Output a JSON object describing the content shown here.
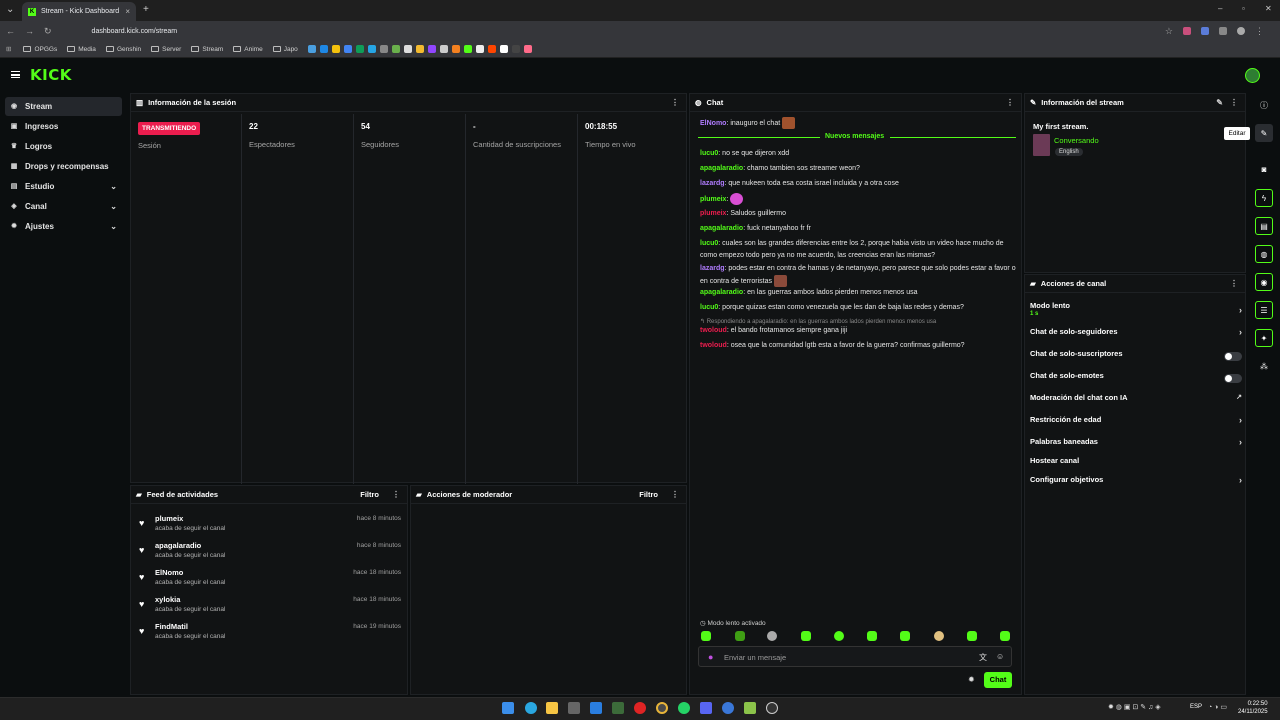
{
  "browser": {
    "tab_title": "Stream - Kick Dashboard",
    "url": "dashboard.kick.com/stream",
    "bookmarks": [
      "OPGGs",
      "Media",
      "Genshin",
      "Server",
      "Stream",
      "Anime",
      "Japo"
    ]
  },
  "brand": {
    "logo": "KICK",
    "accent": "#53fc18"
  },
  "nav": {
    "items": [
      {
        "label": "Stream",
        "icon": "broadcast-icon"
      },
      {
        "label": "Ingresos",
        "icon": "wallet-icon"
      },
      {
        "label": "Logros",
        "icon": "trophy-icon"
      },
      {
        "label": "Drops y recompensas",
        "icon": "gift-icon"
      },
      {
        "label": "Estudio",
        "icon": "studio-icon"
      },
      {
        "label": "Canal",
        "icon": "channel-icon"
      },
      {
        "label": "Ajustes",
        "icon": "gear-icon"
      }
    ]
  },
  "session": {
    "title": "Información de la sesión",
    "badge": "TRANSMITIENDO",
    "badge_label": "Sesión",
    "stats": [
      {
        "value": "22",
        "label": "Espectadores"
      },
      {
        "value": "54",
        "label": "Seguidores"
      },
      {
        "value": "-",
        "label": "Cantidad de suscripciones"
      },
      {
        "value": "00:18:55",
        "label": "Tiempo en vivo"
      }
    ]
  },
  "feed": {
    "title": "Feed de actividades",
    "filter": "Filtro",
    "items": [
      {
        "name": "plumeix",
        "sub": "acaba de seguir el canal",
        "time": "hace 8 minutos"
      },
      {
        "name": "apagalaradio",
        "sub": "acaba de seguir el canal",
        "time": "hace 8 minutos"
      },
      {
        "name": "ElNomo",
        "sub": "acaba de seguir el canal",
        "time": "hace 18 minutos"
      },
      {
        "name": "xylokia",
        "sub": "acaba de seguir el canal",
        "time": "hace 18 minutos"
      },
      {
        "name": "FindMatil",
        "sub": "acaba de seguir el canal",
        "time": "hace 19 minutos"
      }
    ]
  },
  "moderator": {
    "title": "Acciones de moderador",
    "filter": "Filtro"
  },
  "chat": {
    "title": "Chat",
    "new_messages": "Nuevos mensajes",
    "first": {
      "user": "ElNomo",
      "text": ": inauguro el chat",
      "color": "#b07cff"
    },
    "messages": [
      {
        "user": "lucu0",
        "text": ": no se que dijeron xdd",
        "color": "#53fc18"
      },
      {
        "user": "apagalaradio",
        "text": ": chamo tambien sos streamer weon?",
        "color": "#53fc18"
      },
      {
        "user": "lazardg",
        "text": ": que nukeen toda esa costa israel incluida y a otra cose",
        "color": "#b07cff"
      },
      {
        "user": "plumeix",
        "text": ":",
        "color": "#53fc18"
      },
      {
        "user": "plumeix",
        "text": ": Saludos guillermo",
        "color": "#eb1d4e"
      },
      {
        "user": "apagalaradio",
        "text": ": fuck netanyahoo fr fr",
        "color": "#53fc18"
      },
      {
        "user": "lucu0",
        "text": ": cuales son las grandes diferencias entre los 2, porque habia visto un video hace mucho de como empezo todo pero ya no me acuerdo, las creencias eran las mismas?",
        "color": "#53fc18"
      },
      {
        "user": "lazardg",
        "text": ": podes estar en contra de hamas y de netanyayo, pero parece que solo podes estar a favor o en contra de terroristas",
        "color": "#b07cff"
      },
      {
        "user": "apagalaradio",
        "text": ": en las guerras ambos lados pierden menos menos usa",
        "color": "#53fc18"
      },
      {
        "user": "lucu0",
        "text": ": porque quizas estan como venezuela que les dan de baja las redes y demas?",
        "color": "#53fc18"
      },
      {
        "user": "twoloud",
        "text": ": el bando frotamanos siempre gana jiji",
        "color": "#eb1d4e"
      },
      {
        "user": "twoloud",
        "text": ": osea que la comunidad lgtb esta a favor de la guerra? confirmas guillermo?",
        "color": "#eb1d4e"
      }
    ],
    "reply_hint": "Respondiendo a apagalaradio: en las guerras ambos lados pierden menos menos usa",
    "slow_mode": "Modo lento activado",
    "placeholder": "Enviar un mensaje",
    "send": "Chat"
  },
  "stream_info": {
    "title": "Información del stream",
    "stream_title": "My first stream.",
    "category": "Conversando",
    "language": "English",
    "tooltip": "Editar"
  },
  "channel_actions": {
    "title": "Acciones de canal",
    "slow_mode": {
      "label": "Modo lento",
      "value": "1 s"
    },
    "items": [
      {
        "label": "Chat de solo-seguidores",
        "kind": "chevron"
      },
      {
        "label": "Chat de solo-suscriptores",
        "kind": "toggle"
      },
      {
        "label": "Chat de solo-emotes",
        "kind": "toggle"
      },
      {
        "label": "Moderación del chat con IA",
        "kind": "external"
      },
      {
        "label": "Restricción de edad",
        "kind": "chevron"
      },
      {
        "label": "Palabras baneadas",
        "kind": "chevron"
      },
      {
        "label": "Hostear canal",
        "kind": "none"
      },
      {
        "label": "Configurar objetivos",
        "kind": "chevron"
      }
    ]
  },
  "system": {
    "language": "ESP",
    "time": "0:22:50",
    "date": "24/11/2025"
  }
}
